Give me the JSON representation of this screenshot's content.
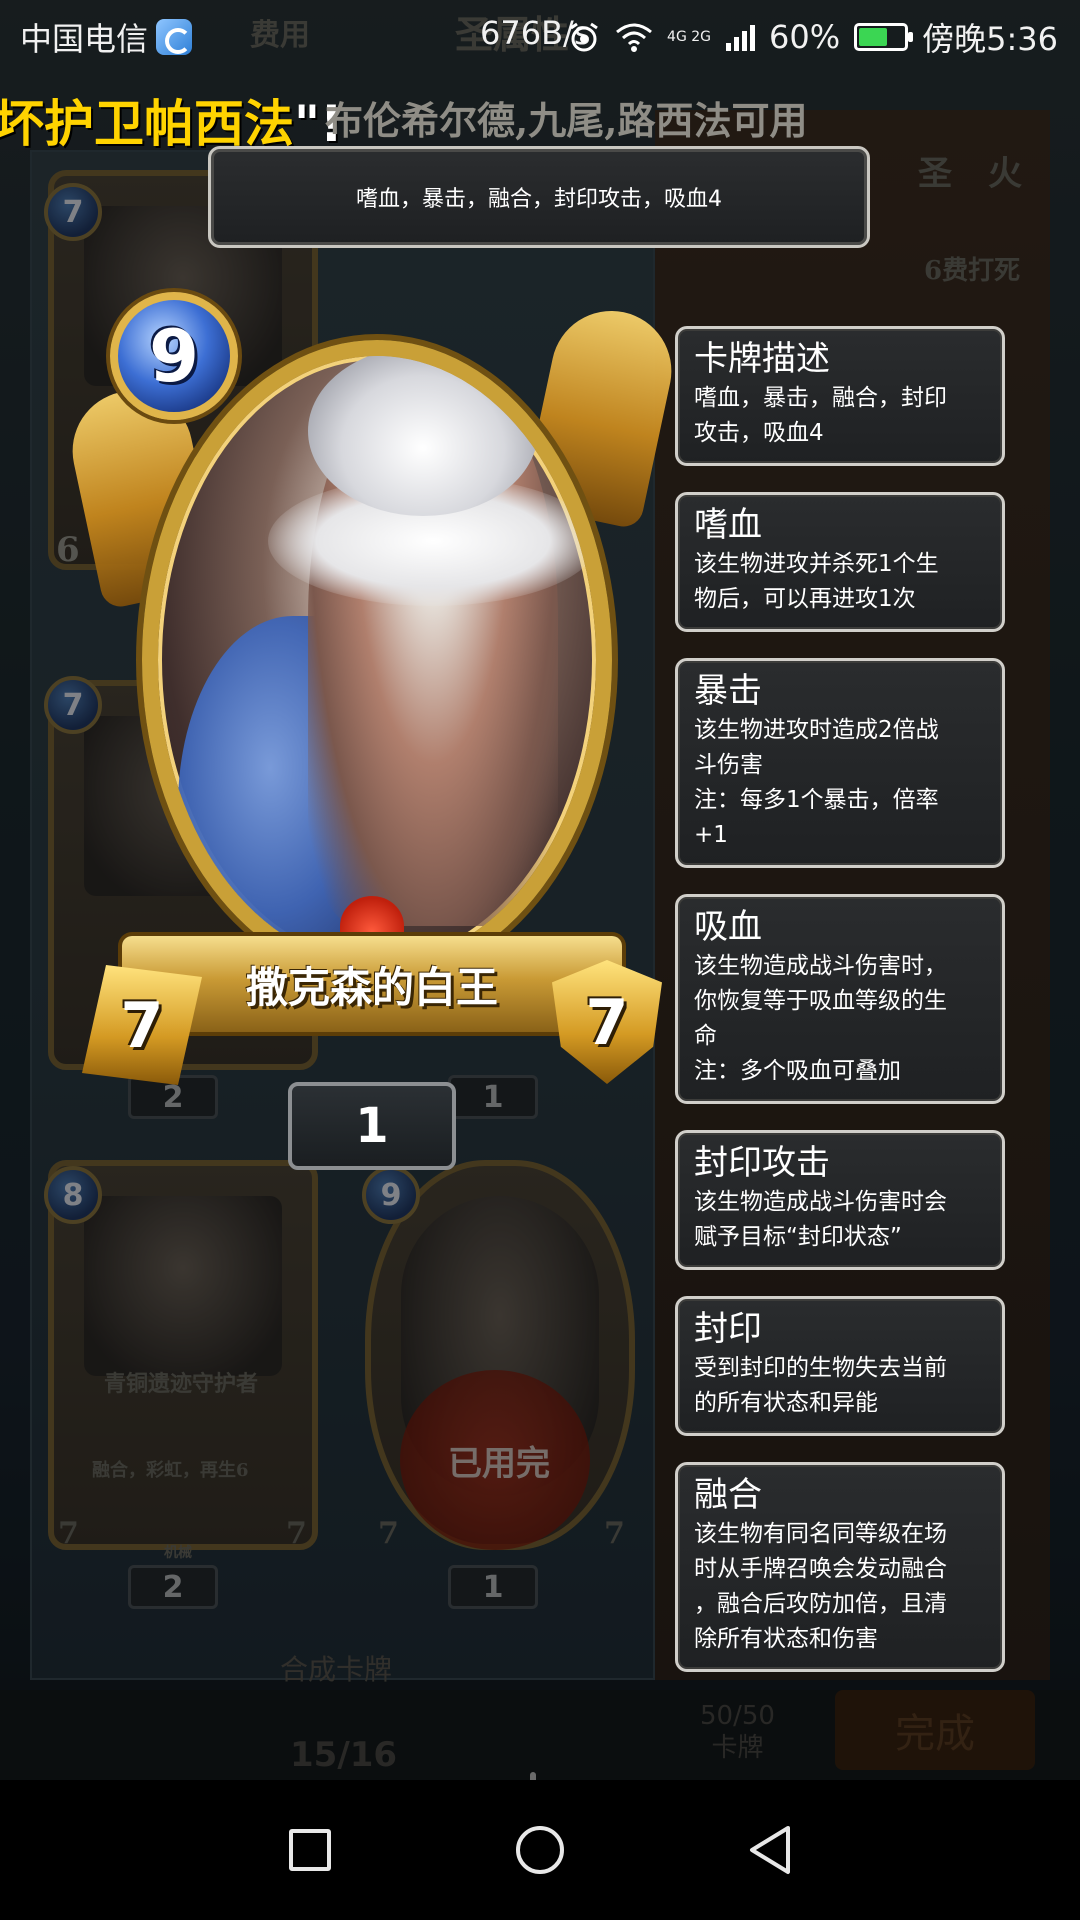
{
  "status_bar": {
    "carrier": "中国电信",
    "speed": "676B/s",
    "network": "4G 2G",
    "battery": "60%",
    "time": "傍晚5:36",
    "battery_level": 0.6,
    "battery_color": "#3bd653"
  },
  "background": {
    "top_tab_left": "费用",
    "top_tab_center": "圣属性",
    "chip_sacred": "圣",
    "chip_fire": "火",
    "deck_label": "6费打死",
    "marquee_yellow": "坏护卫帕西法",
    "marquee_mark": "\"!",
    "marquee_white": "布伦希尔德,九尾,路西法可用",
    "mini_cards": [
      {
        "cost": "7",
        "count": "2"
      },
      {
        "cost": "7",
        "count": ""
      },
      {
        "cost": "8",
        "name": "青铜遗迹守护者",
        "desc": "融合，彩虹，再生6",
        "atk": "7",
        "hp": "7",
        "tag": "机械",
        "count": "2"
      },
      {
        "cost": "9",
        "seal": "已用完",
        "atk": "7",
        "hp": "7",
        "count": "1"
      }
    ],
    "side_count": "6",
    "mid_count": "1",
    "bottom_label": "合成卡牌",
    "bottom_page": "15/16",
    "bottom_count_top": "50/50",
    "bottom_count_bottom": "卡牌",
    "bottom_done": "完成"
  },
  "summary_tooltip": "嗜血，暴击，融合，封印攻击，吸血4",
  "card": {
    "cost": "9",
    "name": "撒克森的白王",
    "attack": "7",
    "health": "7",
    "count": "1"
  },
  "keywords": [
    {
      "title": "卡牌描述",
      "text": "嗜血，暴击，融合，封印\n攻击，吸血4"
    },
    {
      "title": "嗜血",
      "text": "该生物进攻并杀死1个生\n物后，可以再进攻1次"
    },
    {
      "title": "暴击",
      "text": "该生物进攻时造成2倍战\n斗伤害\n注：每多1个暴击，倍率\n+1"
    },
    {
      "title": "吸血",
      "text": "该生物造成战斗伤害时，\n你恢复等于吸血等级的生\n命\n注：多个吸血可叠加"
    },
    {
      "title": "封印攻击",
      "text": "该生物造成战斗伤害时会\n赋予目标“封印状态”"
    },
    {
      "title": "封印",
      "text": "受到封印的生物失去当前\n的所有状态和异能"
    },
    {
      "title": "融合",
      "text": "该生物有同名同等级在场\n时从手牌召唤会发动融合\n，融合后攻防加倍，且清\n除所有状态和伤害"
    }
  ],
  "nav": {
    "recent_icon": "square-icon",
    "home_icon": "circle-icon",
    "back_icon": "triangle-back-icon"
  }
}
